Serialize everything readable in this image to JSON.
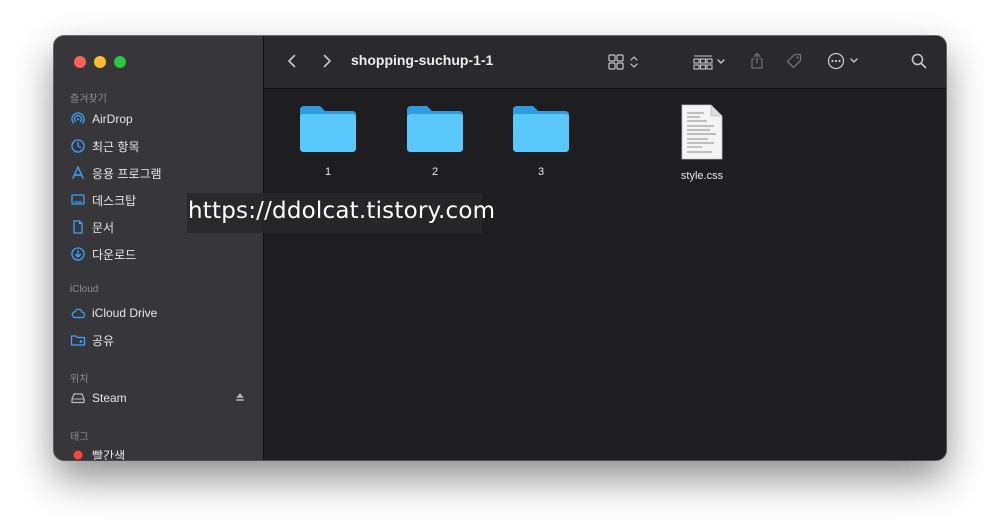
{
  "window": {
    "title": "shopping-suchup-1-1"
  },
  "sidebar": {
    "favorites_header": "즐겨찾기",
    "favorites": [
      {
        "label": "AirDrop",
        "icon": "airdrop-icon"
      },
      {
        "label": "최근 항목",
        "icon": "clock-icon"
      },
      {
        "label": "응용 프로그램",
        "icon": "applications-icon"
      },
      {
        "label": "데스크탑",
        "icon": "desktop-icon"
      },
      {
        "label": "문서",
        "icon": "document-icon"
      },
      {
        "label": "다운로드",
        "icon": "download-icon"
      }
    ],
    "icloud_header": "iCloud",
    "icloud": [
      {
        "label": "iCloud Drive",
        "icon": "cloud-icon"
      },
      {
        "label": "공유",
        "icon": "shared-folder-icon"
      }
    ],
    "locations_header": "위치",
    "locations": [
      {
        "label": "Steam",
        "icon": "drive-icon"
      }
    ],
    "tags_header": "태그",
    "tags": [
      {
        "label": "빨간색",
        "color": "#ff453a"
      }
    ]
  },
  "files": [
    {
      "name": "1",
      "kind": "folder-icon"
    },
    {
      "name": "2",
      "kind": "folder-icon"
    },
    {
      "name": "3",
      "kind": "folder-icon"
    },
    {
      "name": "style.css",
      "kind": "text-file-icon"
    }
  ],
  "watermark": "https://ddolcat.tistory.com",
  "colors": {
    "accent": "#32a0ff",
    "folder": "#5ac8fa",
    "sidebar_icon": "#3ba2ff"
  }
}
